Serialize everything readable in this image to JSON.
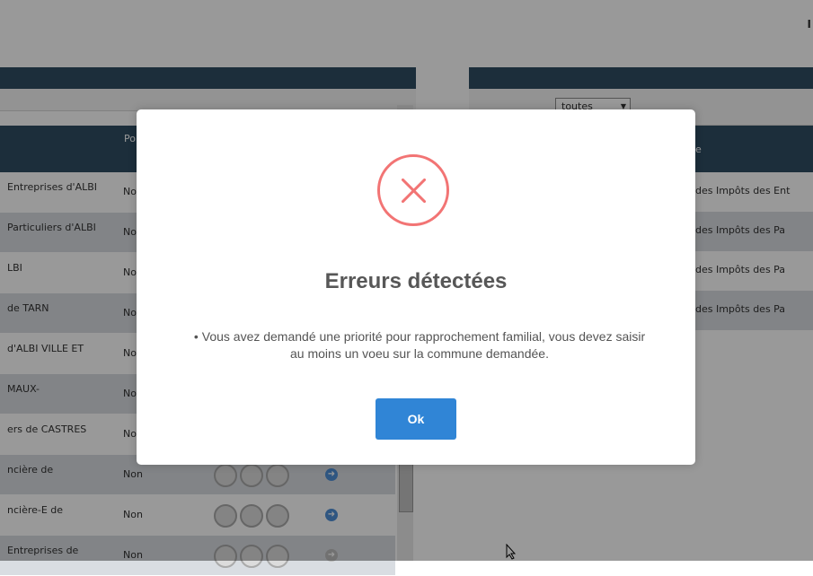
{
  "background": {
    "corner_mark": "I",
    "left_col_header_partial": "Po ch",
    "rows": [
      {
        "name": "Entreprises d'ALBI",
        "prio": "Non"
      },
      {
        "name": "Particuliers d'ALBI",
        "prio": "Non"
      },
      {
        "name": "LBI",
        "prio": "Non"
      },
      {
        "name": "de TARN",
        "prio": "Non"
      },
      {
        "name": "d'ALBI VILLE ET",
        "prio": "Non"
      },
      {
        "name": "MAUX-",
        "prio": "Non"
      },
      {
        "name": "ers de CASTRES",
        "prio": "Non"
      },
      {
        "name": "ncière de",
        "prio": "Non"
      },
      {
        "name": "ncière-E de",
        "prio": "Non"
      },
      {
        "name": "Entreprises de",
        "prio": "Non"
      }
    ],
    "right_filter_value": "toutes",
    "right_col_header_partial": "e",
    "right_rows": [
      "des Impôts des Ent",
      "des Impôts des Pa",
      "des Impôts des Pa",
      "des Impôts des Pa"
    ]
  },
  "dialog": {
    "icon": "error-x-icon",
    "title": "Erreurs détectées",
    "message_bullet": "•",
    "message": "Vous avez demandé une priorité pour rapprochement familial, vous devez saisir au moins un voeu sur la commune demandée.",
    "ok_label": "Ok"
  },
  "colors": {
    "header_bg": "#2f4e63",
    "error_red": "#f27474",
    "ok_blue": "#3085d6"
  }
}
